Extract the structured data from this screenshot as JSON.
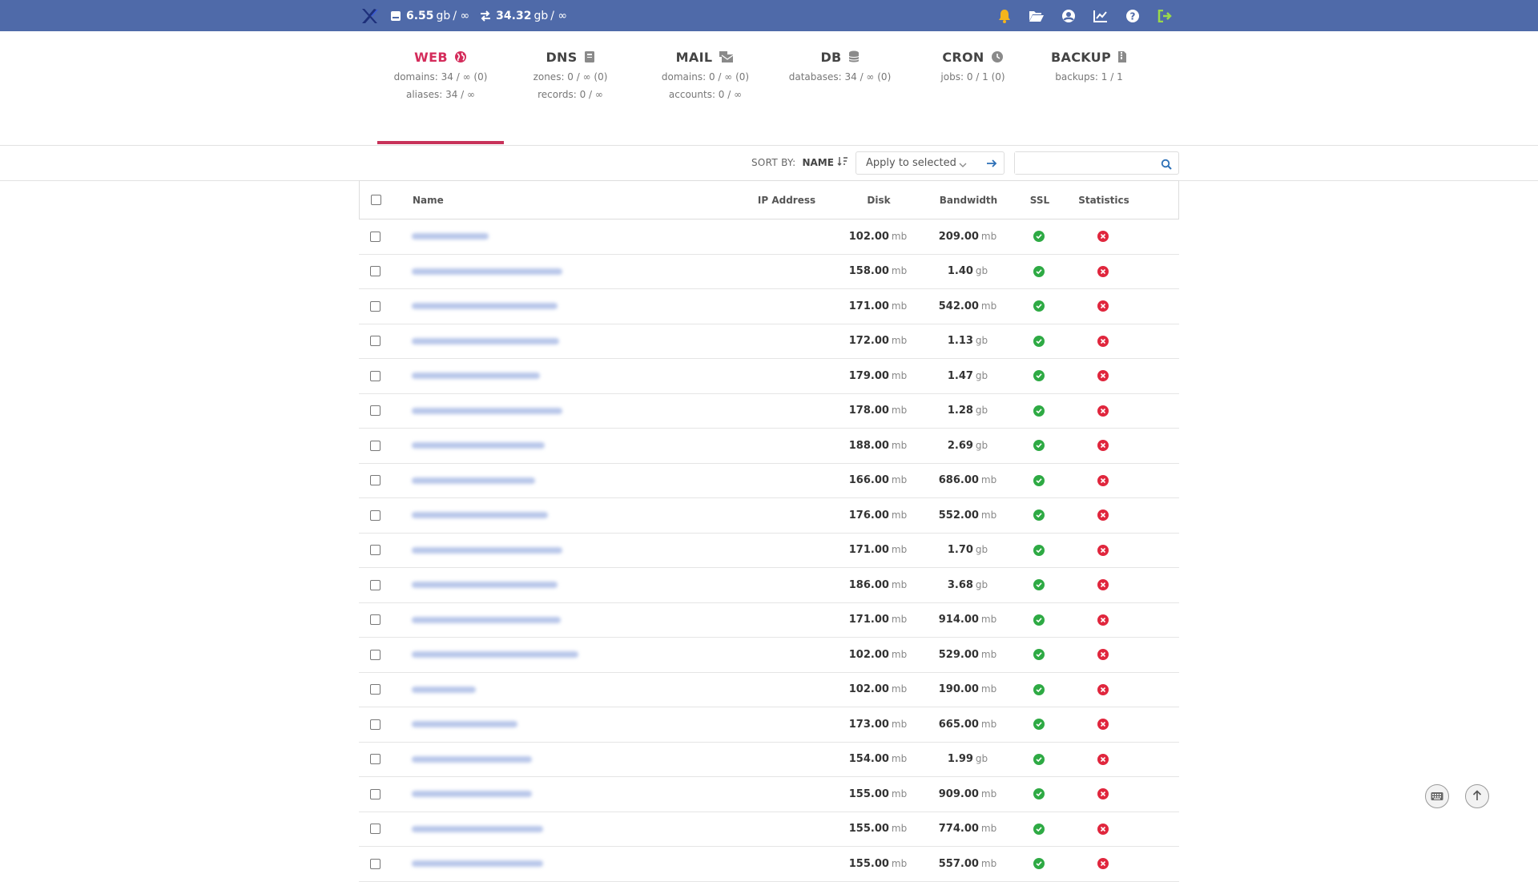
{
  "topbar": {
    "disk_value": "6.55",
    "disk_unit": "gb",
    "disk_limit": "/ ∞",
    "bw_value": "34.32",
    "bw_unit": "gb",
    "bw_limit": "/ ∞",
    "icons": [
      "bell-icon",
      "folder-open-icon",
      "user-circle-icon",
      "chart-line-icon",
      "question-icon",
      "logout-icon"
    ],
    "colors": {
      "bar": "#4f6aa9",
      "bell": "#f5b51b",
      "logout": "#9bd94a"
    }
  },
  "tabs": [
    {
      "title": "WEB",
      "icon": "globe-icon",
      "line1": "domains: 34 / ∞ (0)",
      "line2": "aliases: 34 / ∞",
      "active": true
    },
    {
      "title": "DNS",
      "icon": "book-icon",
      "line1": "zones: 0 / ∞ (0)",
      "line2": "records: 0 / ∞",
      "active": false
    },
    {
      "title": "MAIL",
      "icon": "mail-bulk-icon",
      "line1": "domains: 0 / ∞ (0)",
      "line2": "accounts: 0 / ∞",
      "active": false
    },
    {
      "title": "DB",
      "icon": "database-icon",
      "line1": "databases: 34 / ∞ (0)",
      "line2": "",
      "active": false
    },
    {
      "title": "CRON",
      "icon": "clock-icon",
      "line1": "jobs: 0 / 1 (0)",
      "line2": "",
      "active": false
    },
    {
      "title": "BACKUP",
      "icon": "file-archive-icon",
      "line1": "backups: 1 / 1",
      "line2": "",
      "active": false
    }
  ],
  "toolbar": {
    "sort_label": "SORT BY:",
    "sort_value": "NAME",
    "apply_label": "Apply to selected",
    "search_placeholder": ""
  },
  "table": {
    "headers": {
      "name": "Name",
      "ip": "IP Address",
      "disk": "Disk",
      "bandwidth": "Bandwidth",
      "ssl": "SSL",
      "statistics": "Statistics"
    },
    "rows": [
      {
        "disk": "102.00",
        "disk_unit": "mb",
        "bw": "209.00",
        "bw_unit": "mb",
        "ssl": true,
        "stats": false
      },
      {
        "disk": "158.00",
        "disk_unit": "mb",
        "bw": "1.40",
        "bw_unit": "gb",
        "ssl": true,
        "stats": false
      },
      {
        "disk": "171.00",
        "disk_unit": "mb",
        "bw": "542.00",
        "bw_unit": "mb",
        "ssl": true,
        "stats": false
      },
      {
        "disk": "172.00",
        "disk_unit": "mb",
        "bw": "1.13",
        "bw_unit": "gb",
        "ssl": true,
        "stats": false
      },
      {
        "disk": "179.00",
        "disk_unit": "mb",
        "bw": "1.47",
        "bw_unit": "gb",
        "ssl": true,
        "stats": false
      },
      {
        "disk": "178.00",
        "disk_unit": "mb",
        "bw": "1.28",
        "bw_unit": "gb",
        "ssl": true,
        "stats": false
      },
      {
        "disk": "188.00",
        "disk_unit": "mb",
        "bw": "2.69",
        "bw_unit": "gb",
        "ssl": true,
        "stats": false
      },
      {
        "disk": "166.00",
        "disk_unit": "mb",
        "bw": "686.00",
        "bw_unit": "mb",
        "ssl": true,
        "stats": false
      },
      {
        "disk": "176.00",
        "disk_unit": "mb",
        "bw": "552.00",
        "bw_unit": "mb",
        "ssl": true,
        "stats": false
      },
      {
        "disk": "171.00",
        "disk_unit": "mb",
        "bw": "1.70",
        "bw_unit": "gb",
        "ssl": true,
        "stats": false
      },
      {
        "disk": "186.00",
        "disk_unit": "mb",
        "bw": "3.68",
        "bw_unit": "gb",
        "ssl": true,
        "stats": false
      },
      {
        "disk": "171.00",
        "disk_unit": "mb",
        "bw": "914.00",
        "bw_unit": "mb",
        "ssl": true,
        "stats": false
      },
      {
        "disk": "102.00",
        "disk_unit": "mb",
        "bw": "529.00",
        "bw_unit": "mb",
        "ssl": true,
        "stats": false
      },
      {
        "disk": "102.00",
        "disk_unit": "mb",
        "bw": "190.00",
        "bw_unit": "mb",
        "ssl": true,
        "stats": false
      },
      {
        "disk": "173.00",
        "disk_unit": "mb",
        "bw": "665.00",
        "bw_unit": "mb",
        "ssl": true,
        "stats": false
      },
      {
        "disk": "154.00",
        "disk_unit": "mb",
        "bw": "1.99",
        "bw_unit": "gb",
        "ssl": true,
        "stats": false
      },
      {
        "disk": "155.00",
        "disk_unit": "mb",
        "bw": "909.00",
        "bw_unit": "mb",
        "ssl": true,
        "stats": false
      },
      {
        "disk": "155.00",
        "disk_unit": "mb",
        "bw": "774.00",
        "bw_unit": "mb",
        "ssl": true,
        "stats": false
      },
      {
        "disk": "155.00",
        "disk_unit": "mb",
        "bw": "557.00",
        "bw_unit": "mb",
        "ssl": true,
        "stats": false
      }
    ]
  },
  "floating": {
    "icons": [
      "keyboard-icon",
      "arrow-up-icon"
    ]
  }
}
